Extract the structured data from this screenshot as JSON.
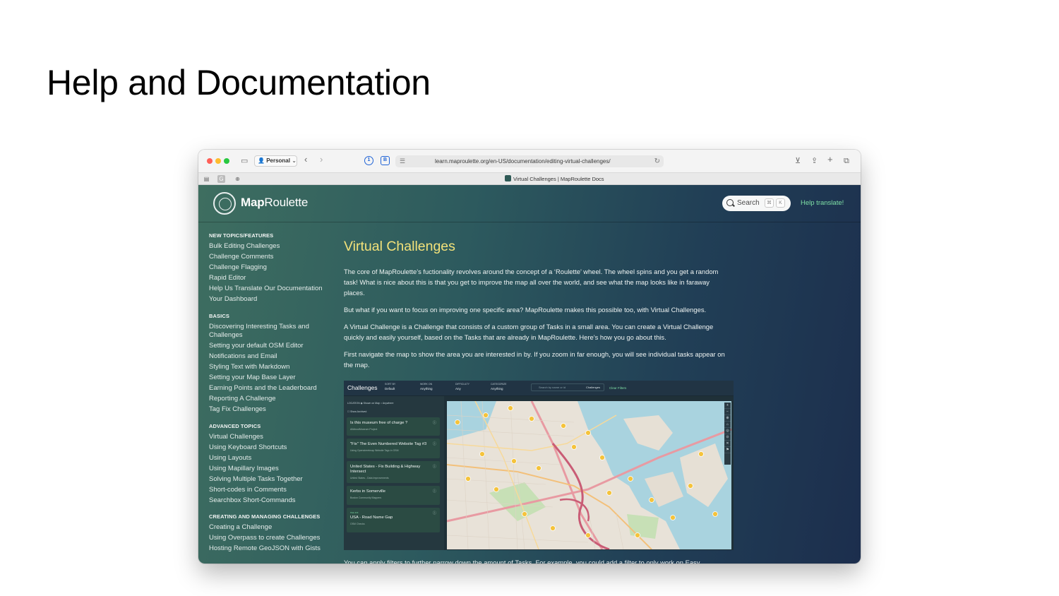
{
  "slide": {
    "title": "Help and Documentation"
  },
  "browser": {
    "profile": "Personal",
    "url": "learn.maproulette.org/en-US/documentation/editing-virtual-challenges/",
    "tab_title": "Virtual Challenges | MapRoulette Docs",
    "icons": [
      "sidebar-icon",
      "back-icon",
      "forward-icon",
      "onepassword-icon",
      "bitwarden-icon",
      "page-settings-icon",
      "reload-icon",
      "download-icon",
      "share-icon",
      "new-tab-icon",
      "tabs-overview-icon"
    ]
  },
  "site": {
    "logo_bold": "Map",
    "logo_rest": "Roulette",
    "search_placeholder": "Search",
    "search_kbd_1": "⌘",
    "search_kbd_2": "K",
    "help_link": "Help translate!"
  },
  "sidebar": {
    "sections": [
      {
        "title": "NEW TOPICS/FEATURES",
        "items": [
          "Bulk Editing Challenges",
          "Challenge Comments",
          "Challenge Flagging",
          "Rapid Editor",
          "Help Us Translate Our Documentation",
          "Your Dashboard"
        ]
      },
      {
        "title": "BASICS",
        "items": [
          "Discovering Interesting Tasks and Challenges",
          "Setting your default OSM Editor",
          "Notifications and Email",
          "Styling Text with Markdown",
          "Setting your Map Base Layer",
          "Earning Points and the Leaderboard",
          "Reporting A Challenge",
          "Tag Fix Challenges"
        ]
      },
      {
        "title": "ADVANCED TOPICS",
        "items": [
          "Virtual Challenges",
          "Using Keyboard Shortcuts",
          "Using Layouts",
          "Using Mapillary Images",
          "Solving Multiple Tasks Together",
          "Short-codes in Comments",
          "Searchbox Short-Commands"
        ]
      },
      {
        "title": "CREATING AND MANAGING CHALLENGES",
        "items": [
          "Creating a Challenge",
          "Using Overpass to create Challenges",
          "Hosting Remote GeoJSON with Gists"
        ]
      }
    ]
  },
  "content": {
    "title": "Virtual Challenges",
    "paragraphs": [
      "The core of MapRoulette’s fuctionality revolves around the concept of a ‘Roulette’ wheel. The wheel spins and you get a random task! What is nice about this is that you get to improve the map all over the world, and see what the map looks like in faraway places.",
      "But what if you want to focus on improving one specific area? MapRoulette makes this possible too, with Virtual Challenges.",
      "A Virtual Challenge is a Challenge that consists of a custom group of Tasks in a small area. You can create a Virtual Challenge quickly and easily yourself, based on the Tasks that are already in MapRoulette. Here’s how you go about this.",
      "First navigate the map to show the area you are interested in by. If you zoom in far enough, you will see individual tasks appear on the map."
    ],
    "trailing_text": "You can apply filters to further narrow down the amount of Tasks. For example, you could add a filter to only work on Easy"
  },
  "screenshot": {
    "title": "Challenges",
    "filters": [
      {
        "label": "SORT BY",
        "value": "Default"
      },
      {
        "label": "WORK ON",
        "value": "Anything"
      },
      {
        "label": "DIFFICULTY",
        "value": "Any"
      },
      {
        "label": "CATEGORIZE",
        "value": "Anything"
      }
    ],
    "search_placeholder": "Search by name or id",
    "search_scope": "Challenges",
    "clear_filters": "Clear Filters",
    "location_label": "LOCATION",
    "location_opt1": "Shown on Map",
    "location_opt2": "Anywhere",
    "show_archived": "Show Archived",
    "cards": [
      {
        "title": "Is this museum free of charge ?",
        "sub": "AllAboutMuseum Project",
        "tag": ""
      },
      {
        "title": "\"Fix\" The Even Numbered Website Tag #3",
        "sub": "Using Openstreetmap Website Tags in OSM",
        "tag": ""
      },
      {
        "title": "United States - Fix Building & Highway Intersect",
        "sub": "United States - Data Improvements",
        "tag": ""
      },
      {
        "title": "Kerbs in Somerville",
        "sub": "Boston Community Mappers",
        "tag": ""
      },
      {
        "title": "USA - Road Name Gap",
        "sub": "OSM Checks",
        "tag": "TAG FIX"
      }
    ],
    "map_controls": [
      "+",
      "−",
      "⊕",
      "⌂",
      "◎",
      "⊙",
      "✕",
      "⚑"
    ]
  }
}
